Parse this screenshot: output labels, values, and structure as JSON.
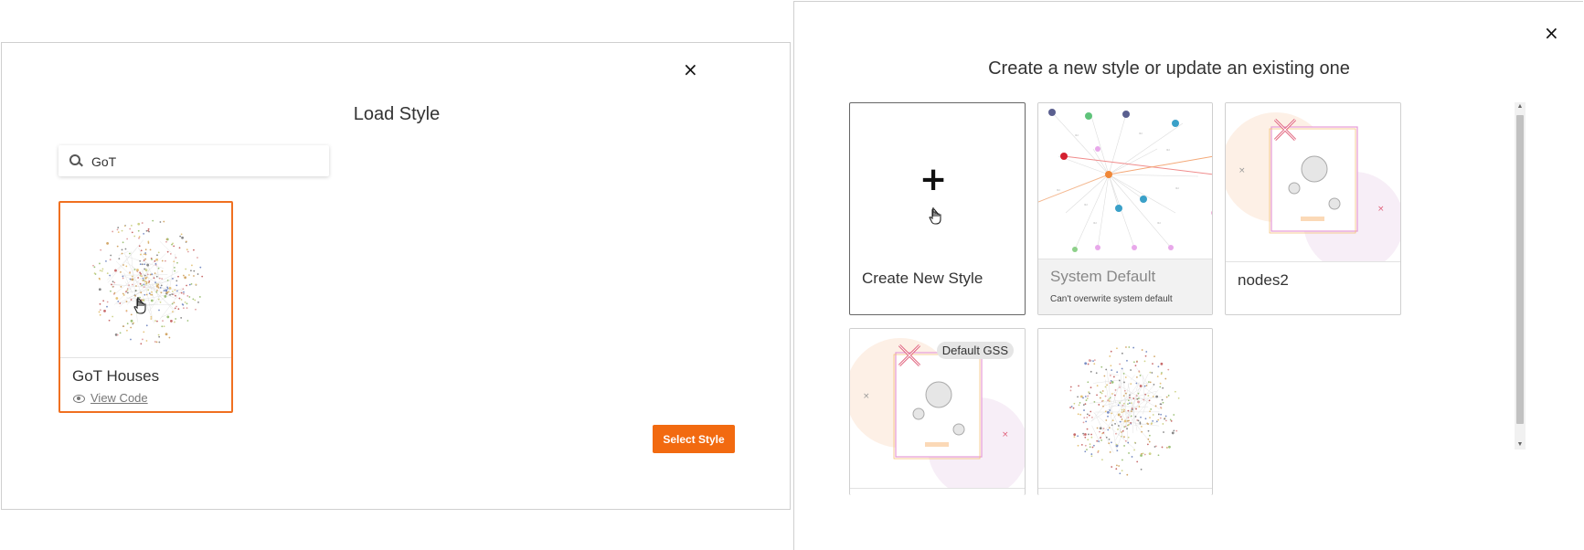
{
  "load_dialog": {
    "title": "Load Style",
    "close_glyph": "×",
    "search": {
      "value": "GoT",
      "icon": "search-icon"
    },
    "cards": [
      {
        "title": "GoT Houses",
        "link": "View Code",
        "link_icon": "eye-icon"
      }
    ],
    "select_button": "Select Style"
  },
  "create_dialog": {
    "title": "Create a new style or update an existing one",
    "close_glyph": "×",
    "cards": [
      {
        "title": "Create New Style",
        "icon": "plus-icon"
      },
      {
        "title": "System Default",
        "note": "Can't overwrite system default"
      },
      {
        "title": "nodes2"
      },
      {
        "badge": "Default GSS"
      },
      {
        "title": ""
      }
    ]
  },
  "colors": {
    "accent": "#f26a10",
    "selected_border": "#f07020"
  }
}
